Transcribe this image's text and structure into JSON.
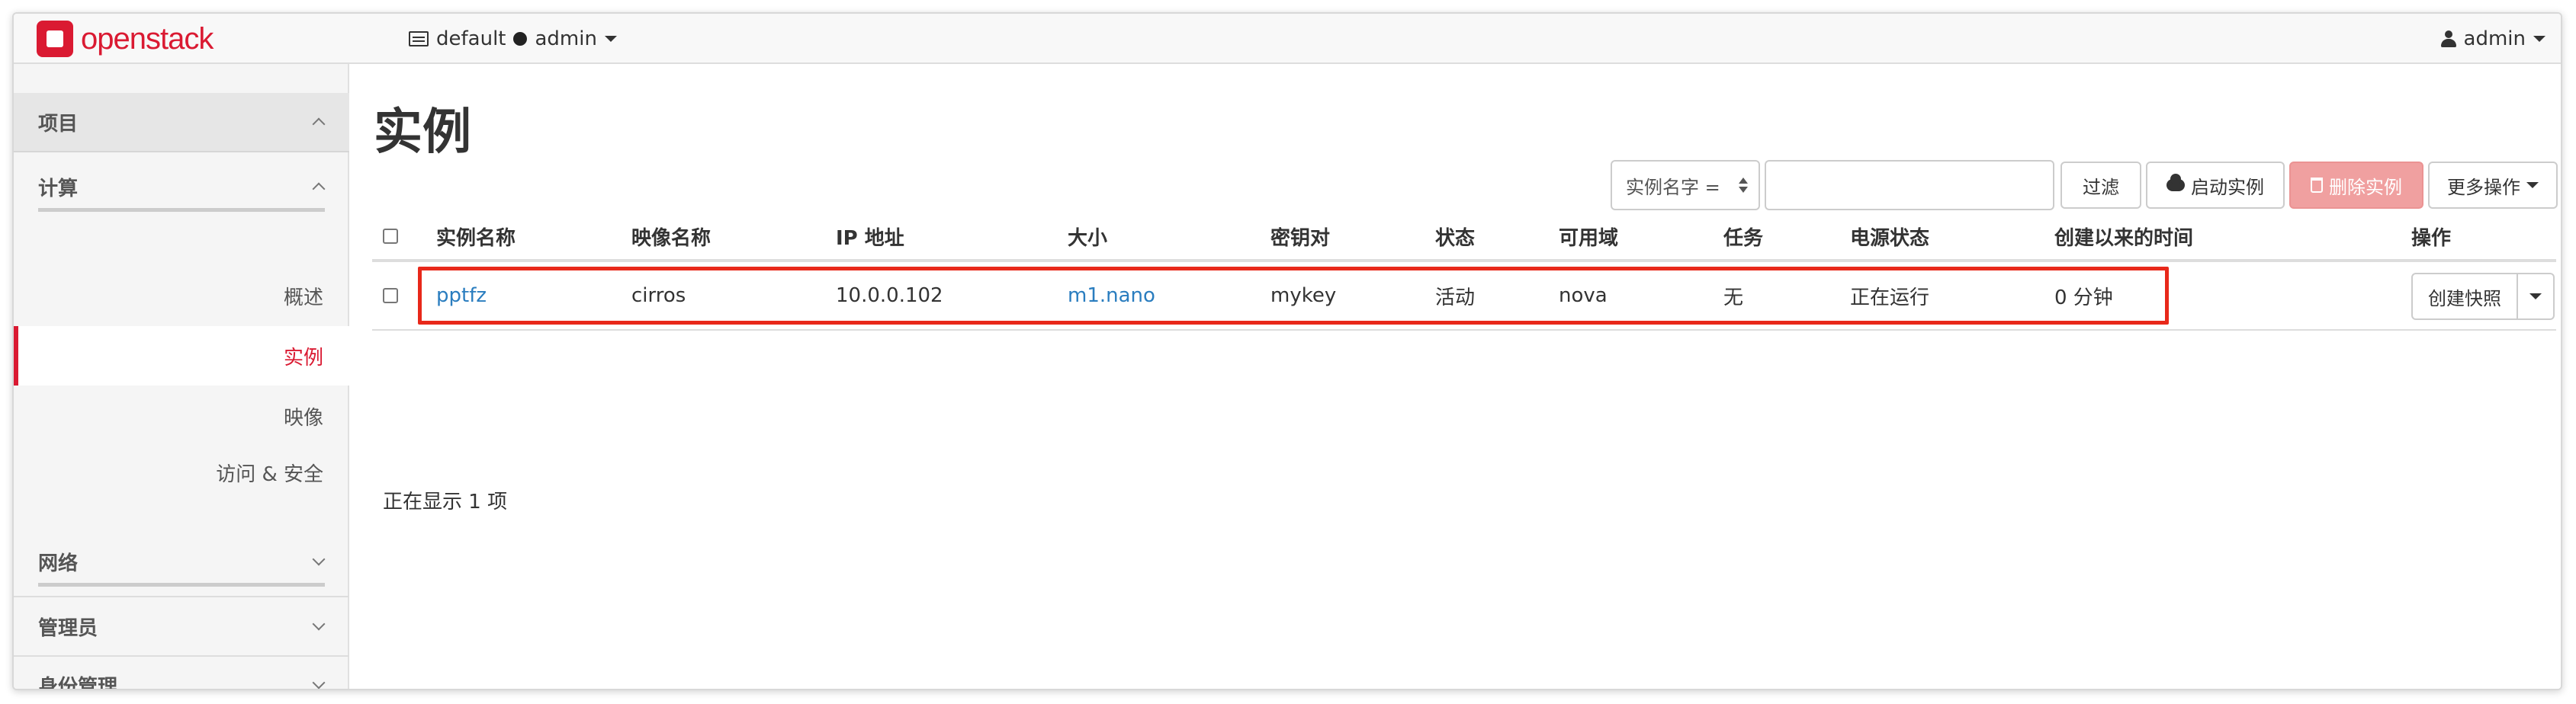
{
  "navbar": {
    "brand": "openstack",
    "project_domain": "default",
    "project_name": "admin",
    "user": "admin"
  },
  "sidebar": {
    "project": "项目",
    "compute": "计算",
    "items": [
      {
        "label": "概述"
      },
      {
        "label": "实例"
      },
      {
        "label": "映像"
      },
      {
        "label": "访问 & 安全"
      }
    ],
    "network": "网络",
    "admin": "管理员",
    "identity": "身份管理"
  },
  "main": {
    "title": "实例",
    "filter": {
      "select_value": "实例名字 =",
      "input_value": "",
      "filter_button": "过滤"
    },
    "actions": {
      "launch": "启动实例",
      "delete": "删除实例",
      "more": "更多操作"
    },
    "table": {
      "headers": [
        "实例名称",
        "映像名称",
        "IP 地址",
        "大小",
        "密钥对",
        "状态",
        "可用域",
        "任务",
        "电源状态",
        "创建以来的时间",
        "操作"
      ],
      "rows": [
        {
          "name": "pptfz",
          "image": "cirros",
          "ip": "10.0.0.102",
          "size": "m1.nano",
          "keypair": "mykey",
          "status": "活动",
          "zone": "nova",
          "task": "无",
          "power": "正在运行",
          "age": "0 分钟",
          "action": "创建快照"
        }
      ]
    },
    "count_text": "正在显示 1 项"
  },
  "colors": {
    "brand": "#da1a32",
    "link": "#2a7dbf",
    "highlight": "#e8281a",
    "danger_disabled": "#f0a0a0"
  }
}
